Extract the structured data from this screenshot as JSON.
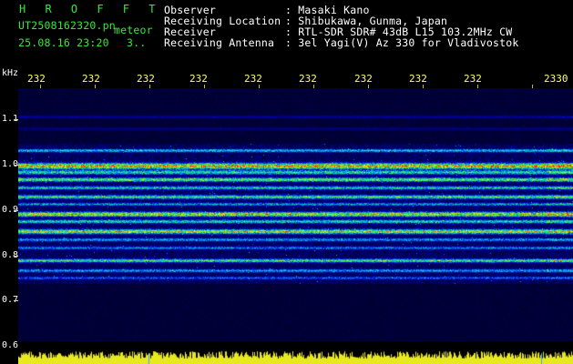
{
  "header": {
    "app_title": "H R O F F T",
    "filename": "UT2508162320.pn",
    "meteor_label": "meteor",
    "datetime": "25.08.16 23:20",
    "count": "3.."
  },
  "info": {
    "labels": [
      "Observer",
      "Receiving Location",
      "Receiver",
      "Receiving Antenna"
    ],
    "values": [
      ": Masaki Kano",
      ": Shibukawa, Gunma, Japan",
      ": RTL-SDR SDR# 43dB L15 103.2MHz CW",
      ": 3el Yagi(V) Az 330 for Vladivostok"
    ]
  },
  "axis": {
    "y_unit": "kHz",
    "y_ticks": [
      "1.1",
      "1.0",
      "0.9",
      "0.8",
      "0.7",
      "0.6"
    ],
    "x_ticks": [
      "232",
      "232",
      "232",
      "232",
      "232",
      "232",
      "232",
      "232",
      "232",
      "2330"
    ]
  },
  "colors": {
    "text_green": "#39e639",
    "tick_yellow": "#ffff66",
    "signal_yellow": "#e8e820"
  }
}
